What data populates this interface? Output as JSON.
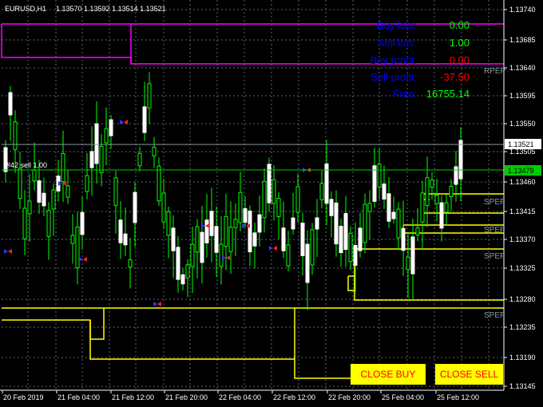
{
  "header": {
    "symbol": "EURUSD,H1",
    "ohlc": "1.13570 1.13592 1.13514 1.13521"
  },
  "info_panel": [
    {
      "label": "Buy lots:",
      "value": "0.00",
      "label_color": "#0000ff",
      "value_color": "#00ff00"
    },
    {
      "label": "Sell lots:",
      "value": "1.00",
      "label_color": "#0000ff",
      "value_color": "#00ff00"
    },
    {
      "label": "Buy profit:",
      "value": "0.00",
      "label_color": "#0000ff",
      "value_color": "#ff0000"
    },
    {
      "label": "Sell profit:",
      "value": "-37.50",
      "label_color": "#0000ff",
      "value_color": "#ff0000"
    },
    {
      "label": "Free:",
      "value": "16755.14",
      "label_color": "#0000ff",
      "value_color": "#00ff00"
    }
  ],
  "order_label": "#42 sell 1.00",
  "price_axis": [
    "1.13740",
    "1.13685",
    "1.13640",
    "1.13595",
    "1.13550",
    "1.13505",
    "1.13460",
    "1.13415",
    "1.13370",
    "1.13325",
    "1.13280",
    "1.13235",
    "1.13190",
    "1.13145"
  ],
  "current_price": "1.13521",
  "order_price": "1.13479",
  "time_axis": [
    "20 Feb 2019",
    "21 Feb 04:00",
    "21 Feb 12:00",
    "21 Feb 20:00",
    "22 Feb 04:00",
    "22 Feb 12:00",
    "22 Feb 20:00",
    "25 Feb 04:00",
    "25 Feb 12:00"
  ],
  "level_labels": [
    "RPEP",
    "SPEP",
    "SPEP",
    "SPEP",
    "SPEP",
    "SPEP"
  ],
  "buttons": {
    "close_buy": "CLOSE BUY",
    "close_sell": "CLOSE SELL"
  },
  "colors": {
    "background": "#000000",
    "bull": "#ffffff",
    "bear": "#00ff00",
    "grid": "#5a6670",
    "magenta": "#ff00ff",
    "yellow": "#ffff00",
    "order_line": "#00cc00"
  }
}
